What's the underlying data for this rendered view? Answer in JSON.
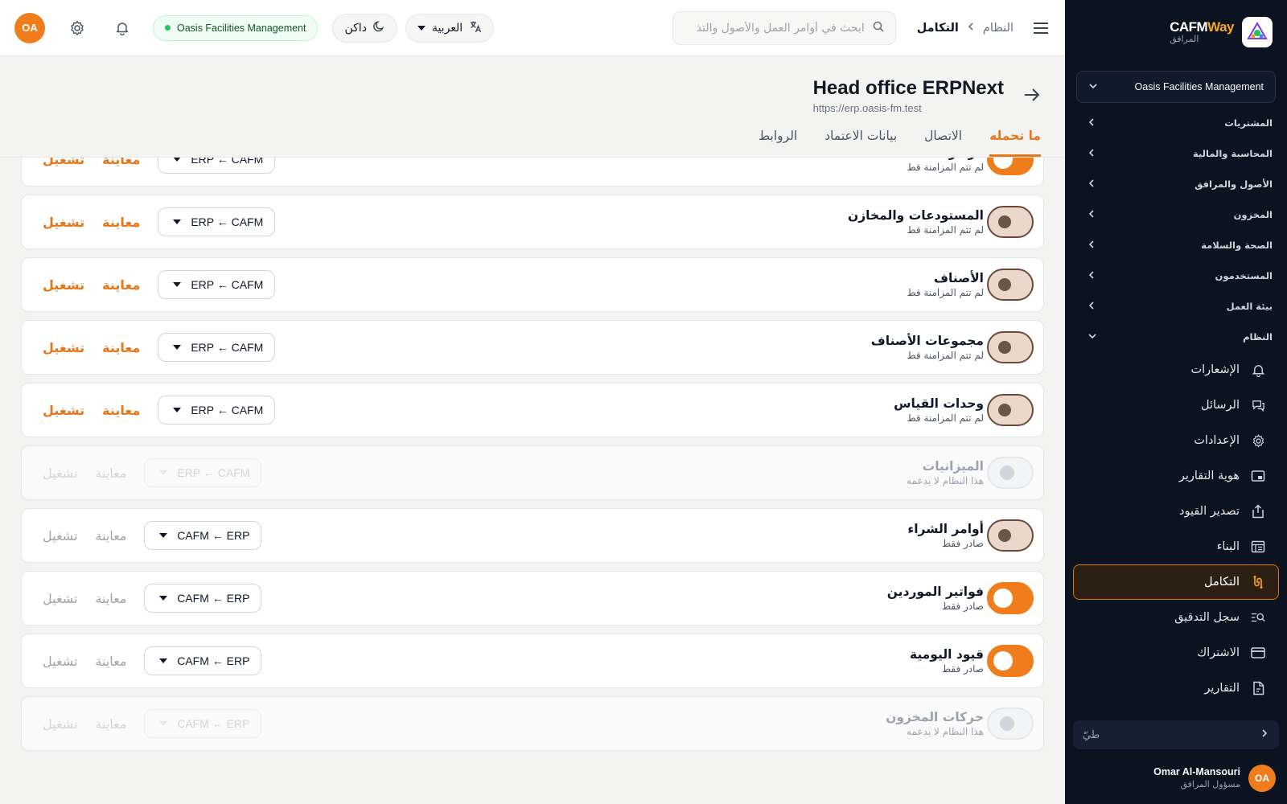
{
  "brand": {
    "name_part1": "CAFM",
    "name_part2": "Way",
    "subtitle": "المرافق"
  },
  "sidebar": {
    "org": "Oasis Facilities Management",
    "sections": [
      {
        "label": "المشتريات",
        "expanded": false
      },
      {
        "label": "المحاسبة والمالية",
        "expanded": false
      },
      {
        "label": "الأصول والمرافق",
        "expanded": false
      },
      {
        "label": "المخزون",
        "expanded": false
      },
      {
        "label": "الصحة والسلامة",
        "expanded": false
      },
      {
        "label": "المستخدمون",
        "expanded": false
      },
      {
        "label": "بيئة العمل",
        "expanded": false
      },
      {
        "label": "النظام",
        "expanded": true
      }
    ],
    "items": [
      {
        "label": "الإشعارات",
        "icon": "bell-icon"
      },
      {
        "label": "الرسائل",
        "icon": "chat-icon"
      },
      {
        "label": "الإعدادات",
        "icon": "gear-icon"
      },
      {
        "label": "هوية التقارير",
        "icon": "report-brand-icon"
      },
      {
        "label": "تصدير القيود",
        "icon": "export-icon"
      },
      {
        "label": "البناء",
        "icon": "builder-icon"
      },
      {
        "label": "التكامل",
        "icon": "integration-icon",
        "active": true
      },
      {
        "label": "سجل التدقيق",
        "icon": "audit-icon"
      },
      {
        "label": "الاشتراك",
        "icon": "card-icon"
      },
      {
        "label": "التقارير",
        "icon": "reports-icon"
      }
    ],
    "collapse_label": "طيّ"
  },
  "user": {
    "initials": "OA",
    "name": "Omar Al-Mansouri",
    "role": "مسؤول المرافق"
  },
  "topbar": {
    "breadcrumb_root": "النظام",
    "breadcrumb_current": "التكامل",
    "search_placeholder": "ابحث في أوامر العمل والأصول والتذا...",
    "language": "العربية",
    "theme": "داكن",
    "org_badge": "Oasis Facilities Management",
    "initials": "OA"
  },
  "page": {
    "title": "Head office ERPNext",
    "url": "https://erp.oasis-fm.test",
    "tabs": [
      "ما تحمله",
      "الاتصال",
      "بيانات الاعتماد",
      "الروابط"
    ]
  },
  "actions": {
    "preview": "معاينة",
    "run": "تشغيل"
  },
  "rows": [
    {
      "title": "مراكز التكلفة",
      "status": "لم تتم المزامنة قط",
      "direction": "ERP ← CAFM",
      "toggle": "on",
      "disabled": false,
      "actions_active": true
    },
    {
      "title": "المستودعات والمخازن",
      "status": "لم تتم المزامنة قط",
      "direction": "ERP ← CAFM",
      "toggle": "mid",
      "disabled": false,
      "actions_active": true
    },
    {
      "title": "الأصناف",
      "status": "لم تتم المزامنة قط",
      "direction": "ERP ← CAFM",
      "toggle": "mid",
      "disabled": false,
      "actions_active": true
    },
    {
      "title": "مجموعات الأصناف",
      "status": "لم تتم المزامنة قط",
      "direction": "ERP ← CAFM",
      "toggle": "mid",
      "disabled": false,
      "actions_active": true
    },
    {
      "title": "وحدات القياس",
      "status": "لم تتم المزامنة قط",
      "direction": "ERP ← CAFM",
      "toggle": "mid",
      "disabled": false,
      "actions_active": true
    },
    {
      "title": "الميزانيات",
      "status": "هذا النظام لا يدعمه",
      "direction": "ERP ← CAFM",
      "toggle": "off",
      "disabled": true,
      "actions_active": false
    },
    {
      "title": "أوامر الشراء",
      "status": "صادر فقط",
      "direction": "CAFM ← ERP",
      "toggle": "mid",
      "disabled": false,
      "actions_active": false
    },
    {
      "title": "فواتير الموردين",
      "status": "صادر فقط",
      "direction": "CAFM ← ERP",
      "toggle": "on",
      "disabled": false,
      "actions_active": false
    },
    {
      "title": "قيود اليومية",
      "status": "صادر فقط",
      "direction": "CAFM ← ERP",
      "toggle": "on",
      "disabled": false,
      "actions_active": false
    },
    {
      "title": "حركات المخزون",
      "status": "هذا النظام لا يدعمه",
      "direction": "CAFM ← ERP",
      "toggle": "off",
      "disabled": true,
      "actions_active": false
    }
  ],
  "colors": {
    "accent": "#e8761a",
    "sidebar_bg": "#0b1220",
    "success": "#22c55e"
  }
}
